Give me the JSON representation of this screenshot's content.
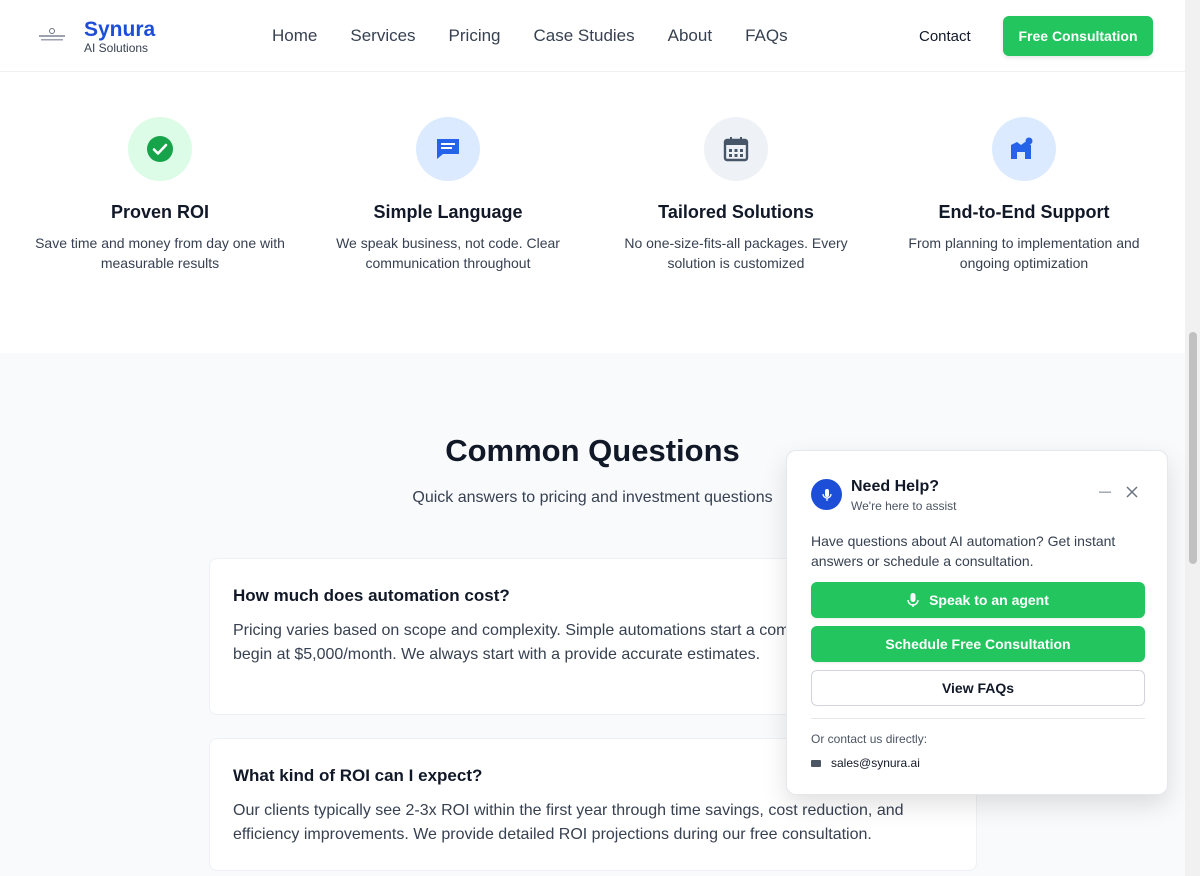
{
  "header": {
    "brand_name": "Synura",
    "brand_sub": "AI Solutions",
    "nav": [
      "Home",
      "Services",
      "Pricing",
      "Case Studies",
      "About",
      "FAQs"
    ],
    "contact": "Contact",
    "cta": "Free Consultation"
  },
  "features": [
    {
      "title": "Proven ROI",
      "desc": "Save time and money from day one with measurable results",
      "icon": "check-circle-icon",
      "bg": "#dcfce7",
      "fg": "#16a34a"
    },
    {
      "title": "Simple Language",
      "desc": "We speak business, not code. Clear communication throughout",
      "icon": "chat-icon",
      "bg": "#dbeafe",
      "fg": "#2563eb"
    },
    {
      "title": "Tailored Solutions",
      "desc": "No one-size-fits-all packages. Every solution is customized",
      "icon": "calendar-icon",
      "bg": "#eef2f6",
      "fg": "#475569"
    },
    {
      "title": "End-to-End Support",
      "desc": "From planning to implementation and ongoing optimization",
      "icon": "support-people-icon",
      "bg": "#dbeafe",
      "fg": "#2563eb"
    }
  ],
  "questions": {
    "title": "Common Questions",
    "subtitle": "Quick answers to pricing and investment questions",
    "items": [
      {
        "q": "How much does automation cost?",
        "a": "Pricing varies based on scope and complexity. Simple automations start a comprehensive programs begin at $5,000/month. We always start with a provide accurate estimates."
      },
      {
        "q": "What kind of ROI can I expect?",
        "a": "Our clients typically see 2-3x ROI within the first year through time savings, cost reduction, and efficiency improvements. We provide detailed ROI projections during our free consultation."
      }
    ]
  },
  "widget": {
    "title": "Need Help?",
    "subtitle": "We're here to assist",
    "message": "Have questions about AI automation? Get instant answers or schedule a consultation.",
    "btn_agent": "Speak to an agent",
    "btn_schedule": "Schedule Free Consultation",
    "btn_faqs": "View FAQs",
    "contact_label": "Or contact us directly:",
    "email": "sales@synura.ai"
  },
  "colors": {
    "brand": "#1d4ed8",
    "accent": "#22c55e"
  }
}
